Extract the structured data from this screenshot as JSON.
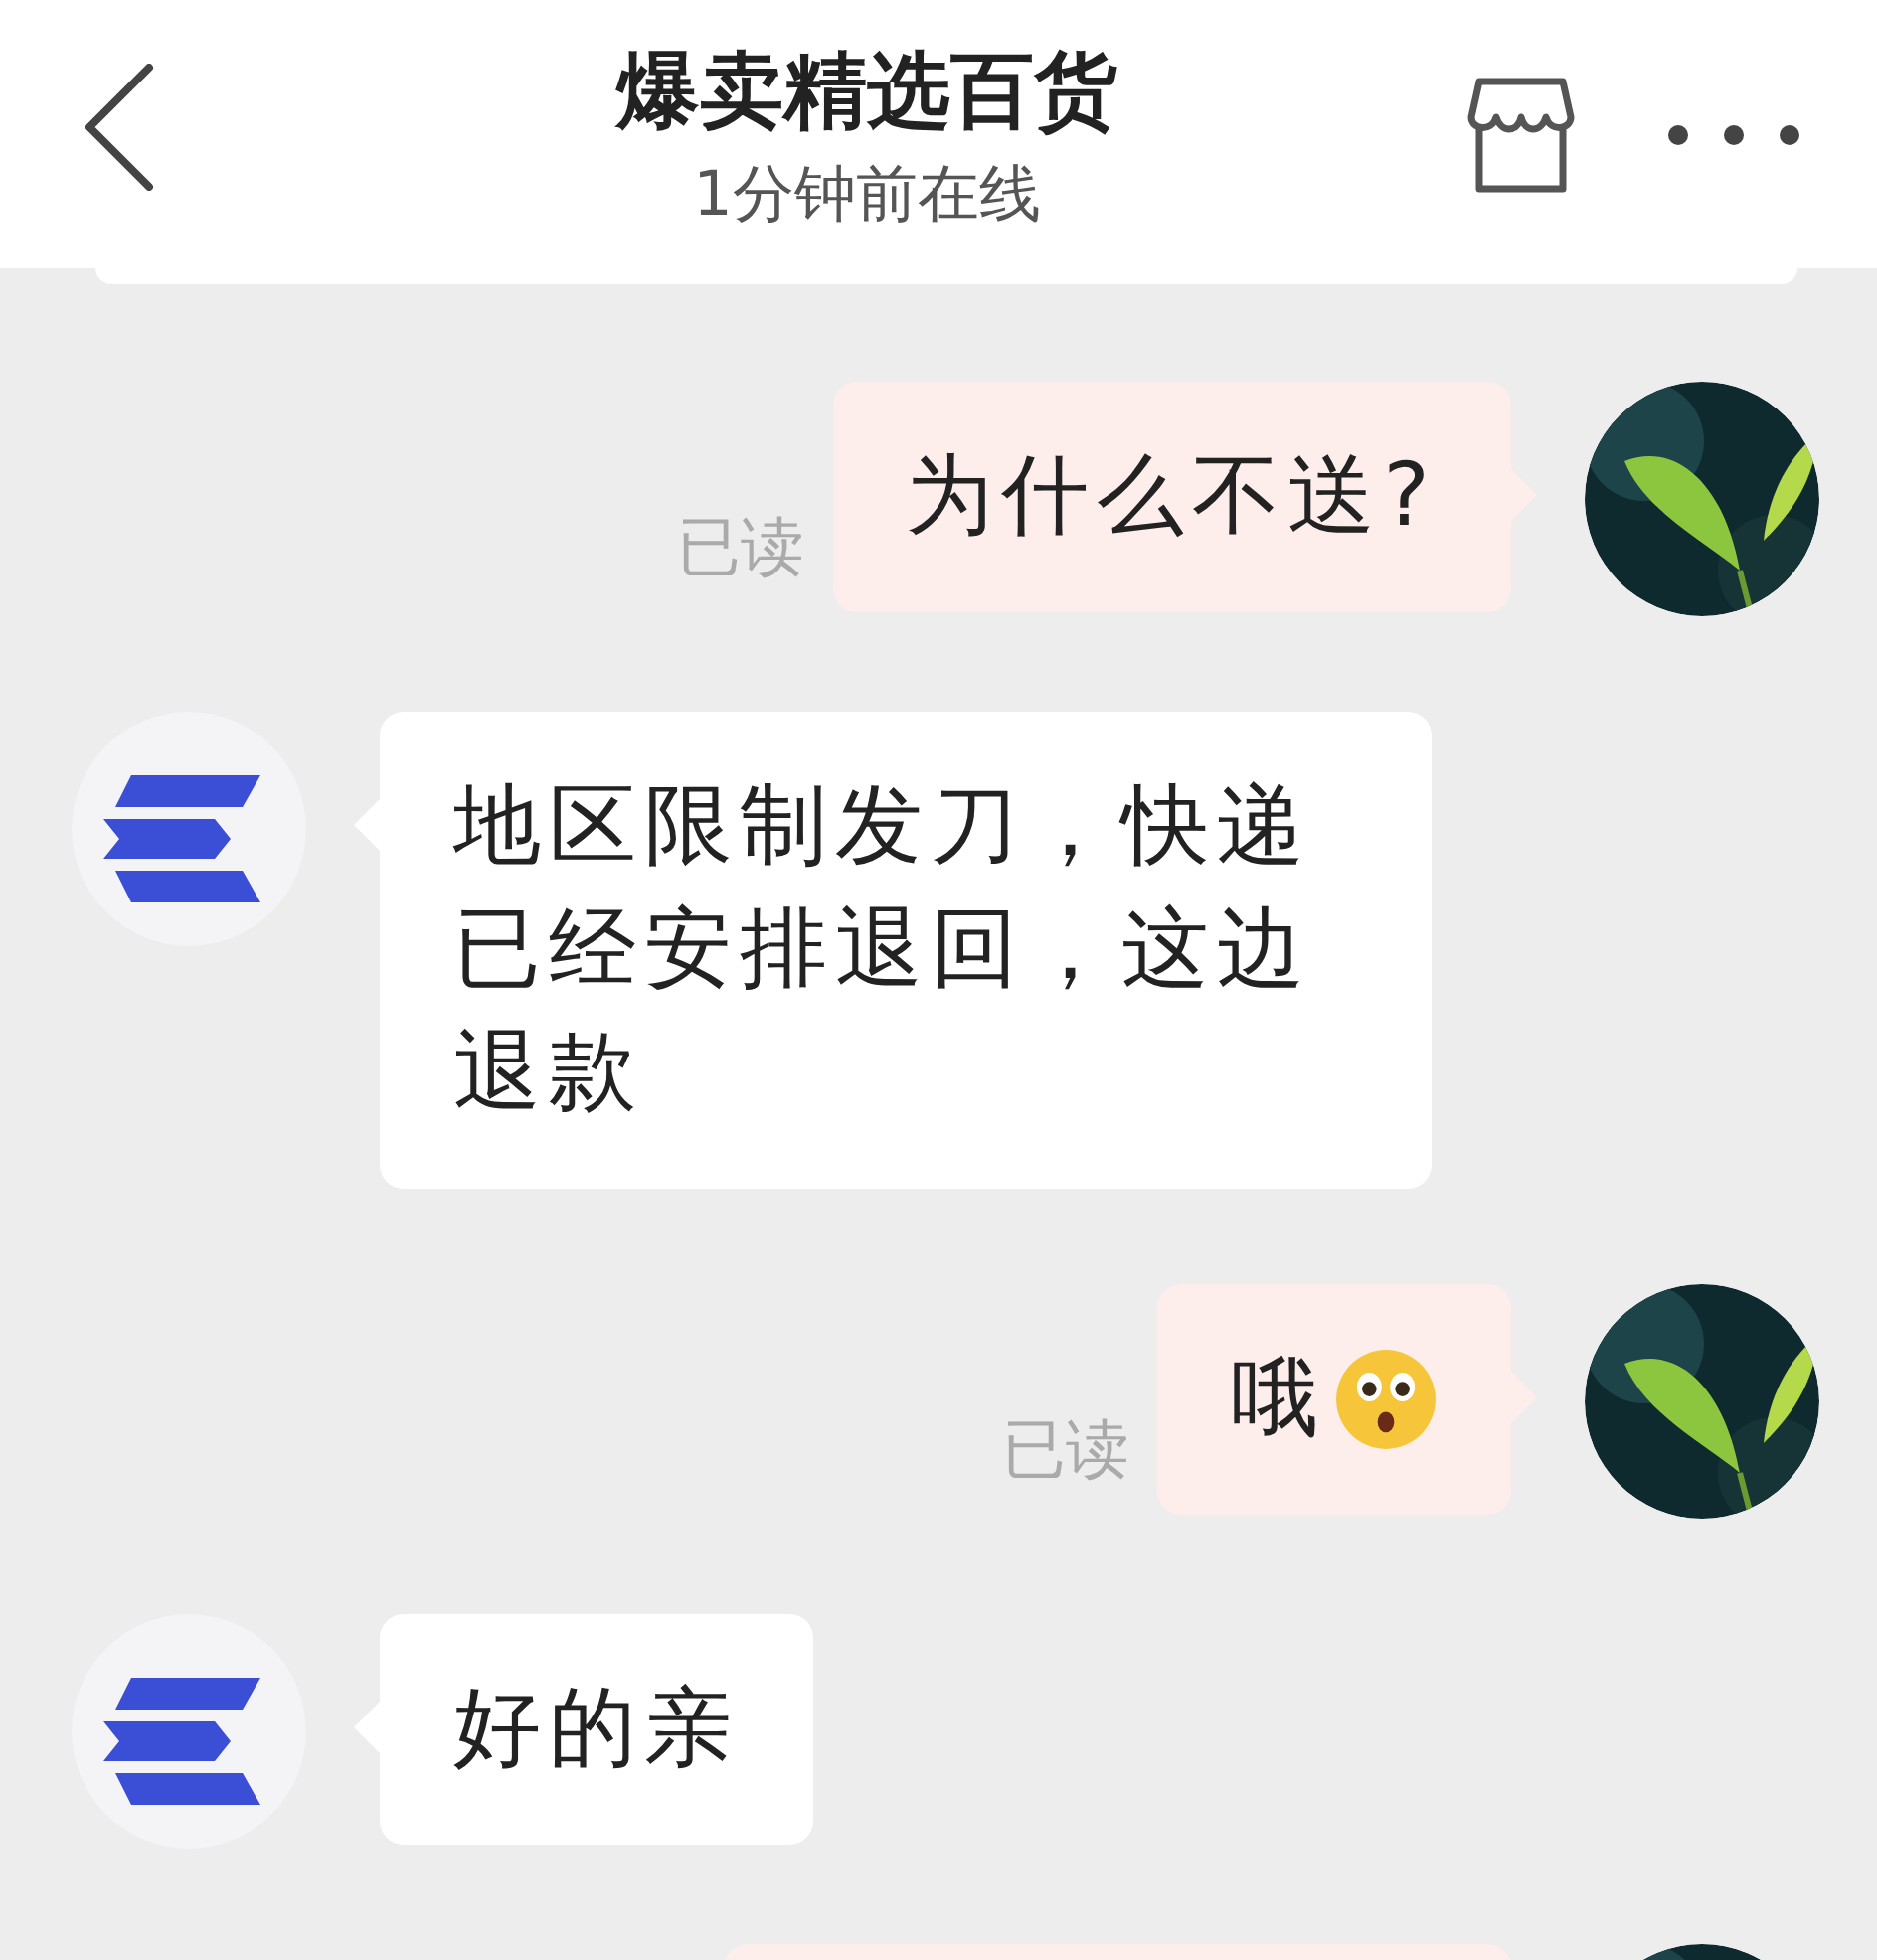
{
  "header": {
    "title": "爆卖精选百货",
    "status": "1分钟前在线"
  },
  "messages": [
    {
      "kind": "sent_text",
      "text": "为什么不送?",
      "read_label": "已读"
    },
    {
      "kind": "received_text",
      "text": "地区限制发刀，快递已经安排退回，这边退款"
    },
    {
      "kind": "sent_emoji_text",
      "text": "哦",
      "read_label": "已读"
    },
    {
      "kind": "received_text",
      "text": "好的亲"
    },
    {
      "kind": "sent_partial"
    }
  ]
}
